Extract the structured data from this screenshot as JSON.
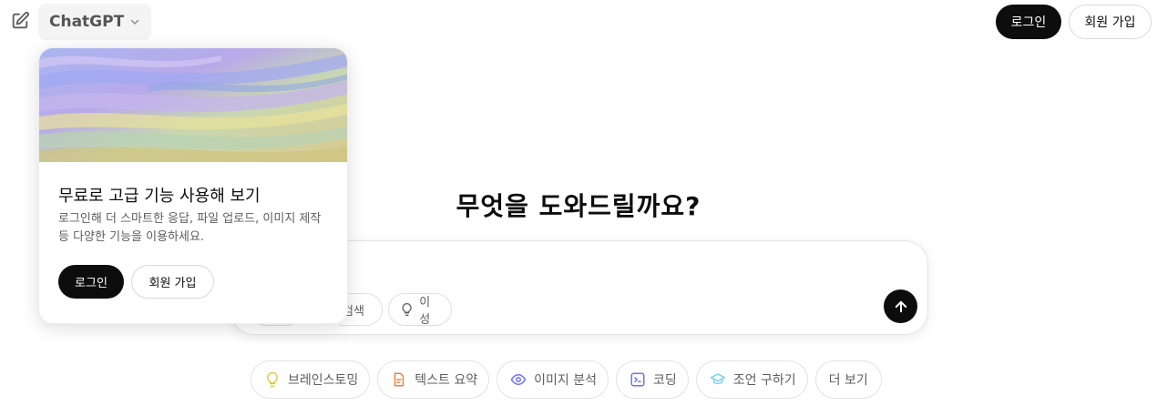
{
  "header": {
    "model_name": "ChatGPT",
    "login_label": "로그인",
    "signup_label": "회원 가입"
  },
  "main": {
    "headline": "무엇을 도와드릴까요?",
    "composer": {
      "tools": [
        {
          "label": "검색",
          "icon": "globe-icon"
        },
        {
          "label": "이성",
          "icon": "lightbulb-icon"
        }
      ],
      "send_icon": "arrow-up-icon"
    },
    "suggestions": [
      {
        "label": "브레인스토밍",
        "icon": "lightbulb-icon",
        "color": "#e2c541"
      },
      {
        "label": "텍스트 요약",
        "icon": "document-icon",
        "color": "#ea8444"
      },
      {
        "label": "이미지 분석",
        "icon": "eye-icon",
        "color": "#6c71ff"
      },
      {
        "label": "코딩",
        "icon": "code-icon",
        "color": "#6c71ff"
      },
      {
        "label": "조언 구하기",
        "icon": "graduation-cap-icon",
        "color": "#76d0eb"
      },
      {
        "label": "더 보기",
        "icon": "",
        "color": ""
      }
    ]
  },
  "popup": {
    "title": "무료로 고급 기능 사용해 보기",
    "description": "로그인해 더 스마트한 응답, 파일 업로드, 이미지 제작 등 다양한 기능을 이용하세요.",
    "login_label": "로그인",
    "signup_label": "회원 가입"
  },
  "colors": {
    "primary_button": "#0d0d0d",
    "text_secondary": "#5d5d5d",
    "border": "#e3e3e3"
  }
}
